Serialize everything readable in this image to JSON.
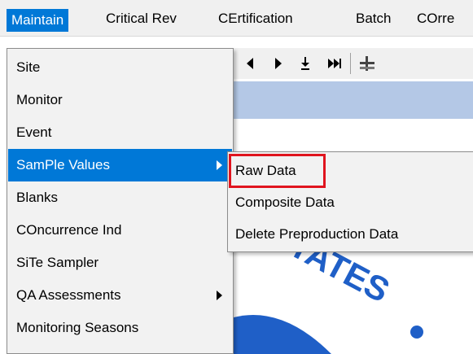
{
  "menubar": {
    "items": [
      {
        "label": "Maintain",
        "active": true
      },
      {
        "label": "Critical Rev"
      },
      {
        "label": "CErtification"
      },
      {
        "label": "Batch"
      },
      {
        "label": "COrre"
      }
    ]
  },
  "toolbar": {
    "buttons": [
      "prev-icon",
      "next-icon",
      "download-icon",
      "fast-forward-icon",
      "add-icon"
    ]
  },
  "background": {
    "seal_text": "STATES"
  },
  "maintain_menu": {
    "items": [
      {
        "label": "Site"
      },
      {
        "label": "Monitor"
      },
      {
        "label": "Event"
      },
      {
        "label": "SamPle Values",
        "highlighted": true,
        "has_submenu": true
      },
      {
        "label": "Blanks"
      },
      {
        "label": "COncurrence Ind"
      },
      {
        "label": "SiTe Sampler"
      },
      {
        "label": "QA Assessments",
        "has_submenu": true
      },
      {
        "label": "Monitoring Seasons"
      }
    ]
  },
  "sample_values_submenu": {
    "items": [
      {
        "label": "Raw Data",
        "callout": true
      },
      {
        "label": "Composite Data"
      },
      {
        "label": "Delete Preproduction Data"
      }
    ]
  },
  "colors": {
    "highlight": "#0078d7",
    "callout_border": "#e0141e",
    "band": "#b4c8e6",
    "seal_blue": "#1f5fc7"
  }
}
